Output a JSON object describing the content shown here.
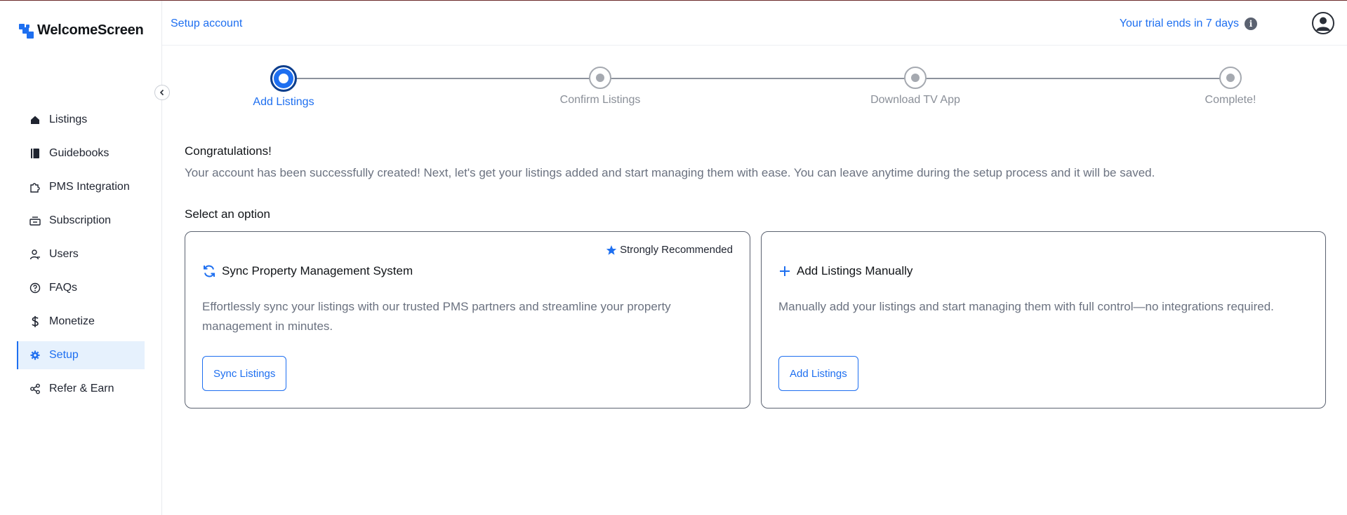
{
  "app": {
    "name": "WelcomeScreen"
  },
  "sidebar": {
    "items": [
      {
        "label": "Listings",
        "icon": "home-icon"
      },
      {
        "label": "Guidebooks",
        "icon": "book-icon"
      },
      {
        "label": "PMS Integration",
        "icon": "puzzle-icon"
      },
      {
        "label": "Subscription",
        "icon": "subscription-icon"
      },
      {
        "label": "Users",
        "icon": "user-icon"
      },
      {
        "label": "FAQs",
        "icon": "question-icon"
      },
      {
        "label": "Monetize",
        "icon": "dollar-icon"
      },
      {
        "label": "Setup",
        "icon": "gear-icon",
        "active": true
      },
      {
        "label": "Refer & Earn",
        "icon": "share-icon"
      }
    ]
  },
  "header": {
    "breadcrumb": "Setup account",
    "trial_text": "Your trial ends in 7 days",
    "info_glyph": "i"
  },
  "stepper": {
    "steps": [
      {
        "label": "Add Listings",
        "state": "active"
      },
      {
        "label": "Confirm Listings",
        "state": "pending"
      },
      {
        "label": "Download TV App",
        "state": "pending"
      },
      {
        "label": "Complete!",
        "state": "pending"
      }
    ]
  },
  "main": {
    "congrats_title": "Congratulations!",
    "congrats_text": "Your account has been successfully created! Next, let's get your listings added and start managing them with ease. You can leave anytime during the setup process and it will be saved.",
    "select_title": "Select an option",
    "options": [
      {
        "badge": "Strongly Recommended",
        "title": "Sync Property Management System",
        "description": "Effortlessly sync your listings with our trusted PMS partners and streamline your property management in minutes.",
        "button": "Sync Listings"
      },
      {
        "title": "Add Listings Manually",
        "description": "Manually add your listings and start managing them with full control—no integrations required.",
        "button": "Add Listings"
      }
    ]
  },
  "colors": {
    "accent": "#1e6ff0",
    "active_bg": "#e6f1fd",
    "muted_text": "#6b7280",
    "step_pending": "#a5a9b0"
  }
}
